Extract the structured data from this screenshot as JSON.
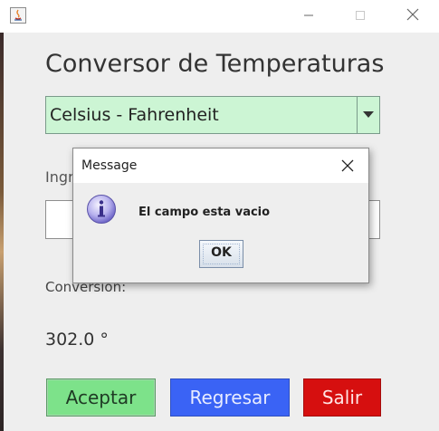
{
  "window": {
    "title": "",
    "controls": {
      "minimize_icon": "minimize-icon",
      "maximize_icon": "maximize-icon",
      "close_icon": "close-icon"
    }
  },
  "main": {
    "title": "Conversor de Temperaturas",
    "combo": {
      "selected": "Celsius - Fahrenheit",
      "color": "#ccf5d4"
    },
    "input_label": "Ingr",
    "input_value": "",
    "conversion_label": "Conversion:",
    "conversion_value": "302.0 °",
    "buttons": {
      "accept": {
        "label": "Aceptar",
        "color": "#7de28a"
      },
      "back": {
        "label": "Regresar",
        "color": "#3a63f5"
      },
      "exit": {
        "label": "Salir",
        "color": "#d60f0f"
      }
    }
  },
  "dialog": {
    "title": "Message",
    "message": "El campo esta vacio",
    "ok_label": "OK",
    "icon": "info-icon"
  }
}
